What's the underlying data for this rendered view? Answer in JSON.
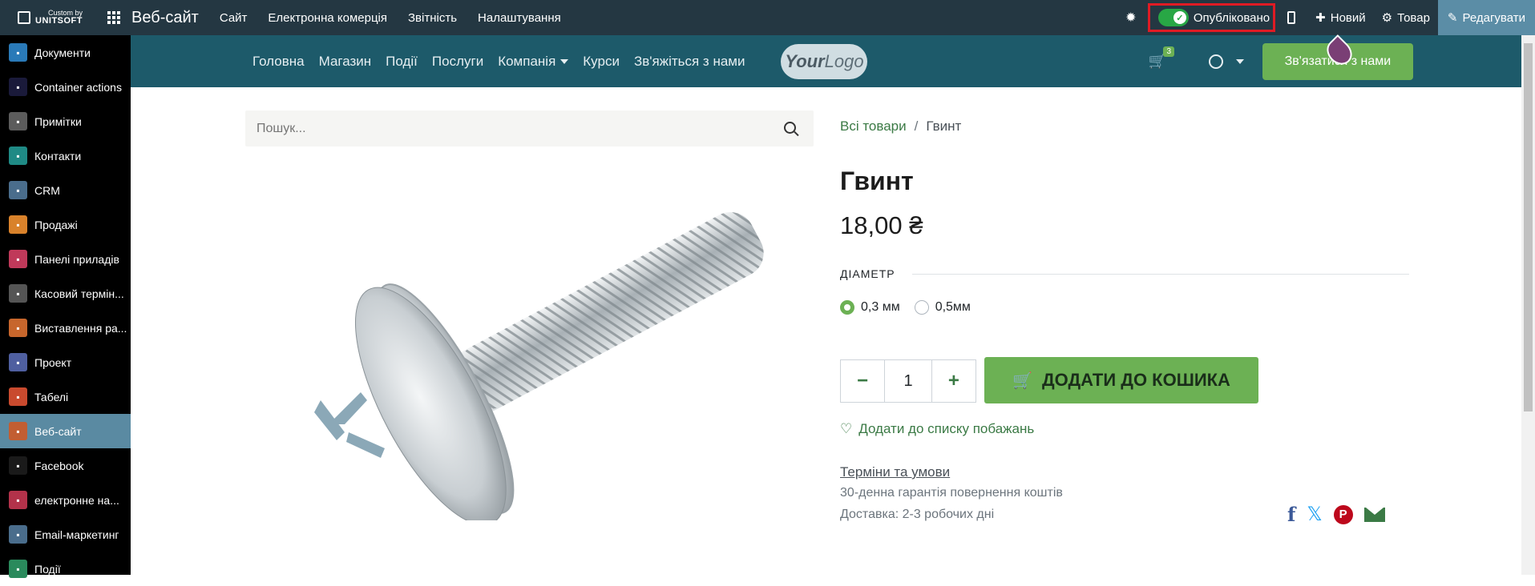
{
  "topbar": {
    "brand_small": "Custom by",
    "brand_big": "UNITSOFT",
    "app_name": "Веб-сайт",
    "menu": [
      "Сайт",
      "Електронна комерція",
      "Звітність",
      "Налаштування"
    ],
    "published_label": "Опубліковано",
    "new_label": "Новий",
    "product_label": "Товар",
    "edit_label": "Редагувати"
  },
  "sidebar": {
    "items": [
      {
        "label": "Документи",
        "icon": "documents-icon",
        "color": "#2a7ab8"
      },
      {
        "label": "Container actions",
        "icon": "container-actions-icon",
        "color": "#1a1a3a"
      },
      {
        "label": "Примітки",
        "icon": "notes-icon",
        "color": "#5c5c5c"
      },
      {
        "label": "Контакти",
        "icon": "contacts-icon",
        "color": "#1f8a85"
      },
      {
        "label": "CRM",
        "icon": "crm-icon",
        "color": "#4a6d8c"
      },
      {
        "label": "Продажі",
        "icon": "sales-icon",
        "color": "#d9822b"
      },
      {
        "label": "Панелі приладів",
        "icon": "dashboard-icon",
        "color": "#c0395a"
      },
      {
        "label": "Касовий термін...",
        "icon": "pos-icon",
        "color": "#555555"
      },
      {
        "label": "Виставлення ра...",
        "icon": "invoicing-icon",
        "color": "#c7662c"
      },
      {
        "label": "Проект",
        "icon": "project-icon",
        "color": "#4f5fa0"
      },
      {
        "label": "Табелі",
        "icon": "timesheets-icon",
        "color": "#c94a2e"
      },
      {
        "label": "Веб-сайт",
        "icon": "website-icon",
        "color": "#c25e32"
      },
      {
        "label": "Facebook",
        "icon": "facebook-icon",
        "color": "#1a1a1a"
      },
      {
        "label": "електронне на...",
        "icon": "elearning-icon",
        "color": "#b3324a"
      },
      {
        "label": "Email-маркетинг",
        "icon": "email-marketing-icon",
        "color": "#4a6d8c"
      },
      {
        "label": "Події",
        "icon": "events-icon",
        "color": "#2a8a5c"
      }
    ],
    "active_index": 11
  },
  "sitenav": {
    "links": [
      "Головна",
      "Магазин",
      "Події",
      "Послуги"
    ],
    "company": "Компанія",
    "links2": [
      "Курси",
      "Зв'яжіться з нами"
    ],
    "logo_a": "Your",
    "logo_b": "Logo",
    "cart_count": "3",
    "contact_button": "Зв'язатися з нами"
  },
  "search": {
    "placeholder": "Пошук..."
  },
  "product": {
    "breadcrumb_all": "Всі товари",
    "breadcrumb_sep": "/",
    "breadcrumb_current": "Гвинт",
    "title": "Гвинт",
    "price": "18,00 ₴",
    "attribute_label": "ДІАМЕТР",
    "options": [
      "0,3 мм",
      "0,5мм"
    ],
    "selected_option": 0,
    "quantity": "1",
    "add_to_cart": "ДОДАТИ ДО КОШИКА",
    "wishlist": "Додати до списку побажань",
    "terms": "Терміни та умови",
    "note1": "30-денна гарантія повернення коштів",
    "note2": "Доставка: 2-3 робочих дні"
  },
  "colors": {
    "topbar": "#243742",
    "sitenav": "#1d5a6a",
    "accent_green": "#6cb154",
    "highlight_red": "#e01b24"
  }
}
